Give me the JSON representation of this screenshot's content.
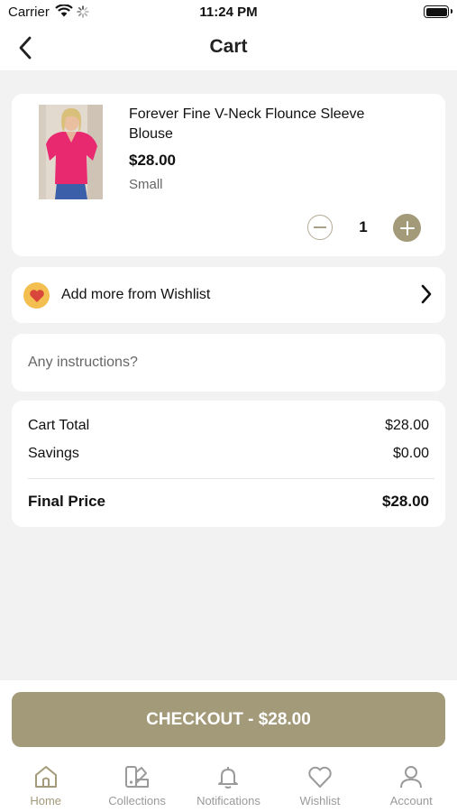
{
  "status_bar": {
    "carrier": "Carrier",
    "time": "11:24 PM"
  },
  "header": {
    "title": "Cart",
    "back_icon": "chevron-left-icon"
  },
  "cart_item": {
    "name": "Forever Fine V-Neck Flounce Sleeve Blouse",
    "price": "$28.00",
    "variant": "Small",
    "quantity": "1",
    "image_icon": "product-photo"
  },
  "wishlist": {
    "label": "Add more from Wishlist",
    "icon": "heart-icon"
  },
  "instructions": {
    "placeholder": "Any instructions?"
  },
  "summary": {
    "total_label": "Cart Total",
    "total_value": "$28.00",
    "savings_label": "Savings",
    "savings_value": "$0.00",
    "final_label": "Final Price",
    "final_value": "$28.00"
  },
  "checkout": {
    "label": "CHECKOUT - $28.00"
  },
  "tabs": [
    {
      "label": "Home",
      "icon": "home-icon",
      "active": true
    },
    {
      "label": "Collections",
      "icon": "collections-icon",
      "active": false
    },
    {
      "label": "Notifications",
      "icon": "bell-icon",
      "active": false
    },
    {
      "label": "Wishlist",
      "icon": "heart-icon",
      "active": false
    },
    {
      "label": "Account",
      "icon": "user-icon",
      "active": false
    }
  ],
  "colors": {
    "accent": "#a39a79",
    "background": "#f2f2f2",
    "wishlist_badge": "#f3bf50",
    "heart": "#d9463c"
  }
}
